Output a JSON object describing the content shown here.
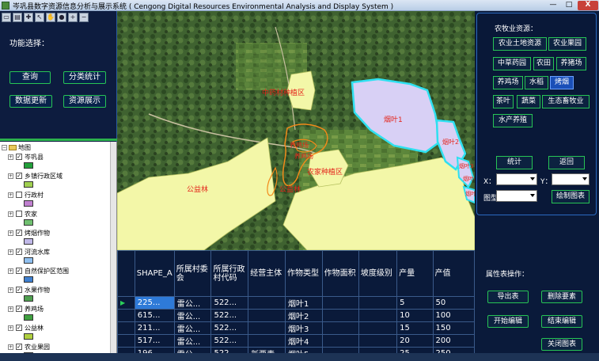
{
  "window": {
    "title": "岑巩县数字资源信息分析与展示系统 ( Cengong Digital Resources Environmental Analysis and Display System )",
    "min_label": "—",
    "max_label": "□",
    "close_label": "X"
  },
  "toolbar": {
    "tools": [
      "open-icon",
      "save-icon",
      "zoom-in-icon",
      "select-arrow-icon",
      "pan-hand-icon",
      "globe-icon",
      "zoom-in-plus-icon",
      "zoom-out-minus-icon"
    ]
  },
  "left_panel": {
    "title": "功能选择：",
    "buttons": {
      "query": "查询",
      "stats": "分类统计",
      "update": "数据更新",
      "show": "资源展示"
    }
  },
  "layers": {
    "root": "地图",
    "items": [
      {
        "label": "岑巩县",
        "checked": true,
        "color": "#22a03a"
      },
      {
        "label": "乡镇行政区域",
        "checked": true,
        "color": "#a0d050"
      },
      {
        "label": "行政村",
        "checked": false,
        "color": "#c080d0"
      },
      {
        "label": "农家",
        "checked": false,
        "color": "#70c070"
      },
      {
        "label": "烤烟作物",
        "checked": true,
        "color": "#c0b8e8"
      },
      {
        "label": "河流水库",
        "checked": true,
        "color": "#90c0f0"
      },
      {
        "label": "自然保护区范围",
        "checked": true,
        "color": "#4080d0"
      },
      {
        "label": "水果作物",
        "checked": true,
        "color": "#50a050"
      },
      {
        "label": "养鸡场",
        "checked": true,
        "color": "#40a040"
      },
      {
        "label": "公益林",
        "checked": true,
        "color": "#b0d040"
      },
      {
        "label": "农业果园",
        "checked": true,
        "color": "#d0a040"
      }
    ]
  },
  "map": {
    "labels": {
      "medicinal_base": "中药材种植区",
      "tobacco1": "烟叶1",
      "tobacco2": "烟叶2",
      "tobacco3": "烟叶3",
      "tobacco4": "烟叶4",
      "tobacco5": "烟叶5",
      "forest_a": "公益林",
      "forest_b": "公益林",
      "fruit_base": "农家种植区",
      "village_a": "养鸡场",
      "chicken_farm": "养鸡场"
    },
    "colors": {
      "tobacco_fill": "#d8d0f5",
      "tobacco_outline": "#2ee0f0",
      "forest_fill": "#f3f7a8",
      "orchard_outline": "#f28a1a",
      "label_red": "#e4251b"
    }
  },
  "right_panel": {
    "title": "农牧业资源：",
    "resources": [
      "农业土地资源",
      "农业果园",
      "中草药园",
      "农田",
      "养猪场",
      "养鸡场",
      "水稻",
      "烤烟",
      "茶叶",
      "蔬菜",
      "生态畜牧业",
      "水产养殖"
    ],
    "selected_resource": "烤烟",
    "stats_label": "统计",
    "back_label": "返回",
    "x_label": "X：",
    "y_label": "Y：",
    "chart_type_label": "图型",
    "draw_chart_label": "绘制图表",
    "x_value": "",
    "y_value": "",
    "chart_type_value": ""
  },
  "table": {
    "columns": [
      "SHAPE_A",
      "所属村委会",
      "所属行政村代码",
      "经营主体",
      "作物类型",
      "作物面积",
      "坡度级别",
      "产量",
      "产值"
    ],
    "rows": [
      [
        "225...",
        "雷公...",
        "522...",
        "",
        "烟叶1",
        "",
        "",
        "5",
        "50"
      ],
      [
        "615...",
        "雷公...",
        "522...",
        "",
        "烟叶2",
        "",
        "",
        "10",
        "100"
      ],
      [
        "211...",
        "雷公...",
        "522...",
        "",
        "烟叶3",
        "",
        "",
        "15",
        "150"
      ],
      [
        "517...",
        "雷公...",
        "522...",
        "",
        "烟叶4",
        "",
        "",
        "20",
        "200"
      ],
      [
        "196...",
        "雷公...",
        "522...",
        "新要素",
        "烟叶5",
        "",
        "",
        "25",
        "250"
      ]
    ],
    "current_row_marker": "▶"
  },
  "ops_panel": {
    "title": "属性表操作：",
    "export": "导出表",
    "delete": "删除要素",
    "start_edit": "开始编辑",
    "end_edit": "结束编辑",
    "close_table": "关闭图表"
  }
}
